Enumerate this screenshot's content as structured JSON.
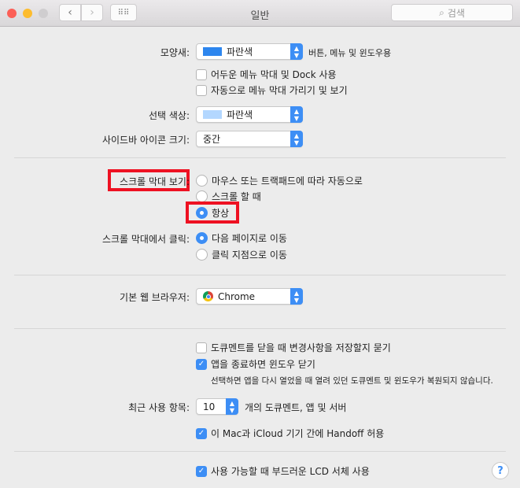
{
  "window": {
    "title": "일반",
    "search_placeholder": "검색",
    "colors": {
      "close": "#fc5f57",
      "minimize": "#fdbc2e",
      "zoom": "#cfcdcf",
      "accent": "#3d8ef5",
      "highlight": "#ee1122"
    }
  },
  "appearance": {
    "label": "모양새:",
    "value": "파란색",
    "swatch_color": "#2d86ee",
    "suffix": "버튼, 메뉴 및 윈도우용",
    "dark_menu": {
      "label": "어두운 메뉴 막대 및 Dock 사용",
      "checked": false
    },
    "auto_hide": {
      "label": "자동으로 메뉴 막대 가리기 및 보기",
      "checked": false
    }
  },
  "highlight": {
    "label": "선택 색상:",
    "value": "파란색",
    "swatch_color": "#b3d7ff"
  },
  "sidebar_icon": {
    "label": "사이드바 아이콘 크기:",
    "value": "중간"
  },
  "scrollbars": {
    "label": "스크롤 막대 보기:",
    "options": [
      "마우스 또는 트랙패드에 따라 자동으로",
      "스크롤 할 때",
      "항상"
    ],
    "selected": "항상"
  },
  "scroll_click": {
    "label": "스크롤 막대에서 클릭:",
    "options": [
      "다음 페이지로 이동",
      "클릭 지점으로 이동"
    ],
    "selected": "다음 페이지로 이동"
  },
  "browser": {
    "label": "기본 웹 브라우저:",
    "value": "Chrome"
  },
  "docs": {
    "ask_save": {
      "label": "도큐멘트를 닫을 때 변경사항을 저장할지 묻기",
      "checked": false
    },
    "close_windows": {
      "label": "앱을 종료하면 윈도우 닫기",
      "checked": true
    },
    "note": "선택하면 앱을 다시 열었을 때 열려 있던 도큐멘트 및 윈도우가 복원되지 않습니다."
  },
  "recent": {
    "label": "최근 사용 항목:",
    "value": "10",
    "suffix": "개의 도큐멘트, 앱 및 서버"
  },
  "handoff": {
    "label": "이 Mac과 iCloud 기기 간에 Handoff 허용",
    "checked": true
  },
  "lcd": {
    "label": "사용 가능할 때 부드러운 LCD 서체 사용",
    "checked": true
  },
  "help": "?"
}
